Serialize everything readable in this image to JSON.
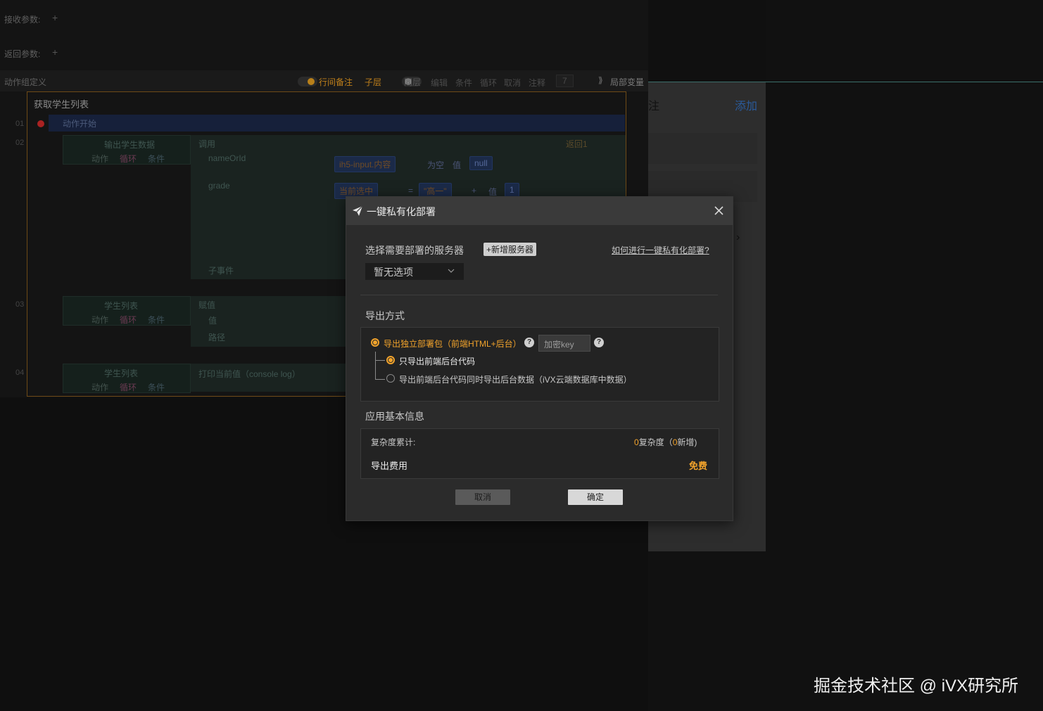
{
  "editor": {
    "receive_params": "接收参数:",
    "return_params": "返回参数:",
    "action_group_def": "动作组定义",
    "line_note": "行间备注",
    "child_layer": "子层",
    "same_layer": "同层",
    "local_var": "局部变量",
    "toolbar_dim": [
      "编辑",
      "条件",
      "循环",
      "取消",
      "注释"
    ],
    "toolbar_num": "7",
    "function_title": "获取学生列表",
    "rows": [
      "01",
      "02",
      "03",
      "04"
    ],
    "action_start": "动作开始",
    "output_node": "输出学生数据",
    "call_label": "调用",
    "return_label": "返回1",
    "param_nameOrId": "nameOrId",
    "param_grade": "grade",
    "sub_event": "子事件",
    "chip_input": "ih5-input.内容",
    "chip_empty": "为空",
    "chip_value": "值",
    "chip_null": "null",
    "chip_selected": "当前选中",
    "chip_eq": "=",
    "chip_grade": "\"高一\"",
    "chip_plus": "+",
    "chip_val2": "值",
    "chip_one": "1",
    "student_list": "学生列表",
    "assign_label": "赋值",
    "value_label": "值",
    "path_label": "路径",
    "print_label": "打印当前值（console log）",
    "tab_action": "动作",
    "tab_loop": "循环",
    "tab_condition": "条件"
  },
  "right": {
    "heading_char": "注",
    "add_label": "添加"
  },
  "modal": {
    "title": "一键私有化部署",
    "choose_server": "选择需要部署的服务器",
    "add_server": "+新增服务器",
    "help_link": "如何进行一键私有化部署?",
    "select_value": "暂无选项",
    "export_mode": "导出方式",
    "option_standalone": "导出独立部署包（前端HTML+后台）",
    "encrypt_placeholder": "加密key",
    "option_code_only": "只导出前端后台代码",
    "option_with_data": "导出前端后台代码同时导出后台数据（iVX云端数据库中数据）",
    "app_info": "应用基本信息",
    "complexity_label": "复杂度累计:",
    "complexity_value": "0",
    "complexity_unit": "复杂度（",
    "complexity_new": "0",
    "complexity_new_label": "新增)",
    "export_fee_label": "导出费用",
    "export_fee_value": "免费",
    "cancel": "取消",
    "confirm": "确定"
  },
  "watermark": "掘金技术社区 @ iVX研究所",
  "colors": {
    "accent_orange": "#f2a32b",
    "modal_bg": "#2b2b2b",
    "link_blue": "#2a5b9c"
  }
}
